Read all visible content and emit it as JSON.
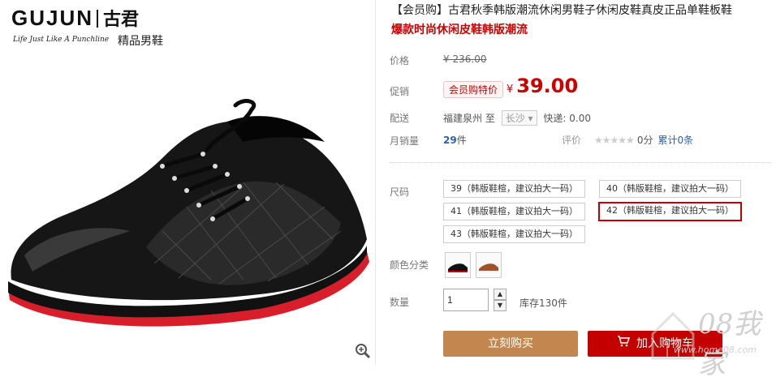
{
  "brand": {
    "logo": "GUJUN",
    "logo_cn": "古君",
    "tagline": "Life Just Like A Punchline",
    "subtitle": "精品男鞋"
  },
  "product": {
    "title": "【会员购】古君秋季韩版潮流休闲男鞋子休闲皮鞋真皮正品单鞋板鞋",
    "subtitle": "爆款时尚休闲皮鞋韩版潮流"
  },
  "price": {
    "label": "价格",
    "currency": "¥",
    "original": "236.00"
  },
  "promo": {
    "label": "促销",
    "badge": "会员购特价",
    "currency": "¥",
    "price": "39.00"
  },
  "shipping": {
    "label": "配送",
    "origin": "福建泉州",
    "to": "至",
    "city": "长沙",
    "fee": "快递: 0.00"
  },
  "sales": {
    "label": "月销量",
    "count": "29",
    "unit": "件"
  },
  "rating": {
    "label": "评价",
    "stars": "★★★★★",
    "score": "0分",
    "reviews": "累计0条"
  },
  "size": {
    "label": "尺码",
    "options": [
      "39（韩版鞋楦，建议拍大一码）",
      "40（韩版鞋楦，建议拍大一码）",
      "41（韩版鞋楦，建议拍大一码）",
      "42（韩版鞋楦，建议拍大一码）",
      "43（韩版鞋楦，建议拍大一码）"
    ],
    "selected": "42"
  },
  "color": {
    "label": "颜色分类"
  },
  "quantity": {
    "label": "数量",
    "value": "1",
    "stock": "库存130件"
  },
  "actions": {
    "buy": "立刻购买",
    "cart": "加入购物车"
  },
  "watermark": {
    "text": "08我家",
    "url": "www.home08.com"
  },
  "colors": {
    "accent_red": "#c40000",
    "buy_button": "#c2874e"
  }
}
